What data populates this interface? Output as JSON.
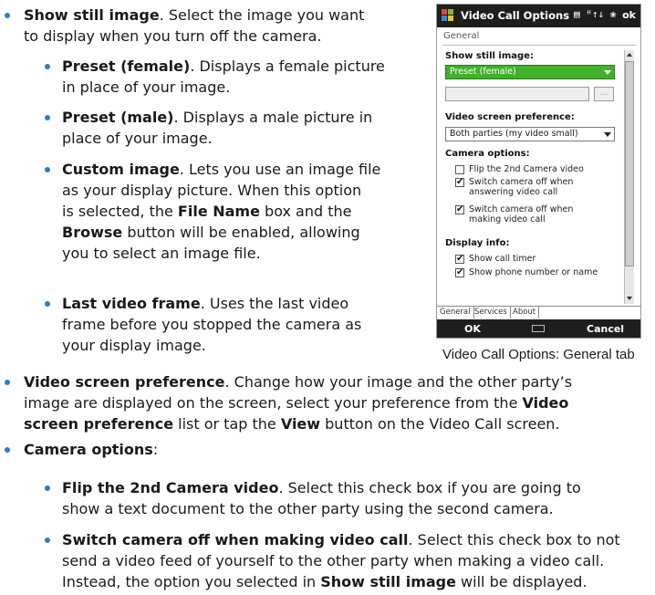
{
  "bullets": {
    "show_still": {
      "bold": "Show still image",
      "text1": ". Select the image you want",
      "text2": "to display when you turn off the camera."
    },
    "preset_female": {
      "bold": "Preset (female)",
      "text1": ". Displays a female picture",
      "text2": "in place of your image."
    },
    "preset_male": {
      "bold": "Preset (male)",
      "text1": ". Displays a male picture in",
      "text2": "place of your image."
    },
    "custom_image": {
      "bold": "Custom image",
      "l1": ". Lets you use an image file",
      "l2": "as your display picture. When this option",
      "l3a": "is selected, the ",
      "l3b": "File Name",
      "l3c": " box and the",
      "l4a": "Browse",
      "l4b": " button will be enabled, allowing",
      "l5": "you to select an image file."
    },
    "last_frame": {
      "bold": "Last video frame",
      "l1": ". Uses the last video",
      "l2": "frame before you stopped the camera as",
      "l3": "your display image."
    },
    "video_pref": {
      "bold": "Video screen preference",
      "l1": ". Change how your image and the other party’s",
      "l2a": "image are displayed on the screen, select your preference from the ",
      "l2b": "Video",
      "l3a": "screen preference",
      "l3b": " list or tap the ",
      "l3c": "View",
      "l3d": " button on the Video Call screen."
    },
    "camera_options": {
      "bold": "Camera options",
      "text": ":"
    },
    "flip": {
      "bold": "Flip the 2nd Camera video",
      "l1": ". Select this check box if you are going to",
      "l2": "show a text document to the other party using the second camera."
    },
    "switch_off": {
      "bold": "Switch camera off when making video call",
      "l1": ". Select this check box to not",
      "l2": "send a video feed of yourself to the other party when making a video call.",
      "l3a": "Instead, the option you selected in ",
      "l3b": "Show still image",
      "l3c": " will be displayed."
    }
  },
  "phone": {
    "title": "Video Call Options",
    "status": "▤ ᴴ↑↓ ❀",
    "ok": "ok",
    "section": "General",
    "show_still_label": "Show still image:",
    "show_still_value": "Preset (female)",
    "video_pref_label": "Video screen preference:",
    "video_pref_value": "Both parties (my video small)",
    "camera_options_label": "Camera options:",
    "cb1": "Flip the 2nd Camera video",
    "cb2a": "Switch camera off when",
    "cb2b": "answering video call",
    "cb3a": "Switch camera off when",
    "cb3b": "making video call",
    "display_info_label": "Display info:",
    "cb4": "Show call timer",
    "cb5": "Show phone number or name",
    "tabs": [
      "General",
      "Services",
      "About"
    ],
    "soft_left": "OK",
    "soft_right": "Cancel",
    "browse": "...",
    "checkmark": "✔"
  },
  "caption": "Video Call Options: General tab",
  "colors": {
    "bullet": "#2b7bd0",
    "dropdown_highlight": "#41b02a",
    "titlebar": "#1e1e1e"
  }
}
